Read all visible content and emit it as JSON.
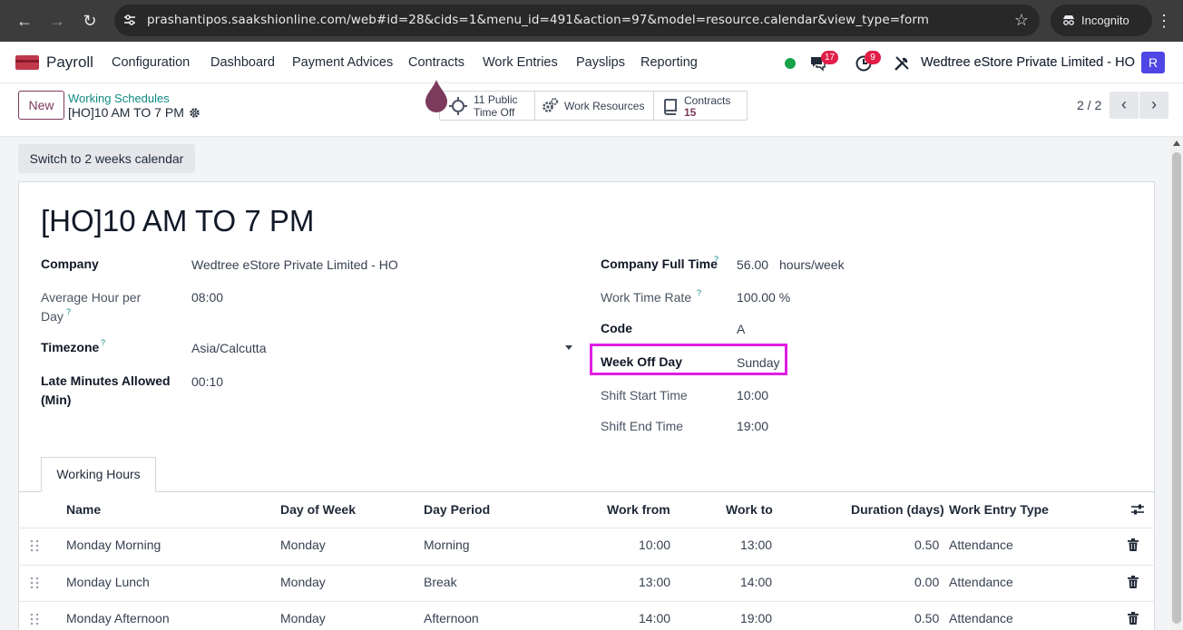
{
  "browser": {
    "url": "prashantipos.saakshionline.com/web#id=28&cids=1&menu_id=491&action=97&model=resource.calendar&view_type=form",
    "incognito_label": "Incognito"
  },
  "navbar": {
    "app_name": "Payroll",
    "menu": [
      "Configuration",
      "Dashboard",
      "Payment Advices",
      "Contracts",
      "Work Entries",
      "Payslips",
      "Reporting"
    ],
    "messages_count": "17",
    "activities_count": "9",
    "company": "Wedtree eStore Private Limited - HO",
    "avatar_letter": "R"
  },
  "control_panel": {
    "new_label": "New",
    "breadcrumb_parent": "Working Schedules",
    "record_name": "[HO]10 AM TO 7 PM",
    "smart_buttons": {
      "public_time_off": {
        "count": "11",
        "label_1": "Public",
        "label_2": "Time Off"
      },
      "work_resources": {
        "label": "Work Resources"
      },
      "contracts": {
        "label": "Contracts",
        "count": "15"
      }
    },
    "pager": "2 / 2"
  },
  "form": {
    "switch_button": "Switch to 2 weeks calendar",
    "title": "[HO]10 AM TO 7 PM",
    "left": {
      "company_label": "Company",
      "company_value": "Wedtree eStore Private Limited - HO",
      "avg_hour_label_1": "Average Hour per",
      "avg_hour_label_2": "Day",
      "avg_hour_value": "08:00",
      "timezone_label": "Timezone",
      "timezone_value": "Asia/Calcutta",
      "late_label_1": "Late Minutes Allowed",
      "late_label_2": "(Min)",
      "late_value": "00:10"
    },
    "right": {
      "full_time_label": "Company Full Time",
      "full_time_value": "56.00",
      "full_time_unit": "hours/week",
      "rate_label": "Work Time Rate",
      "rate_value": "100.00 %",
      "code_label": "Code",
      "code_value": "A",
      "week_off_label": "Week Off Day",
      "week_off_value": "Sunday",
      "shift_start_label": "Shift Start Time",
      "shift_start_value": "10:00",
      "shift_end_label": "Shift End Time",
      "shift_end_value": "19:00"
    },
    "tooltip_mark": "?",
    "tab_label": "Working Hours",
    "table": {
      "headers": {
        "name": "Name",
        "day_of_week": "Day of Week",
        "day_period": "Day Period",
        "work_from": "Work from",
        "work_to": "Work to",
        "duration": "Duration (days)",
        "entry_type": "Work Entry Type"
      },
      "rows": [
        {
          "name": "Monday Morning",
          "day": "Monday",
          "period": "Morning",
          "from": "10:00",
          "to": "13:00",
          "duration": "0.50",
          "type": "Attendance"
        },
        {
          "name": "Monday Lunch",
          "day": "Monday",
          "period": "Break",
          "from": "13:00",
          "to": "14:00",
          "duration": "0.00",
          "type": "Attendance"
        },
        {
          "name": "Monday Afternoon",
          "day": "Monday",
          "period": "Afternoon",
          "from": "14:00",
          "to": "19:00",
          "duration": "0.50",
          "type": "Attendance"
        }
      ]
    }
  },
  "colors": {
    "brand": "#7c3a5c",
    "accent_teal": "#0f8a83",
    "highlight": "#e11de4",
    "badge": "#e11d48"
  }
}
